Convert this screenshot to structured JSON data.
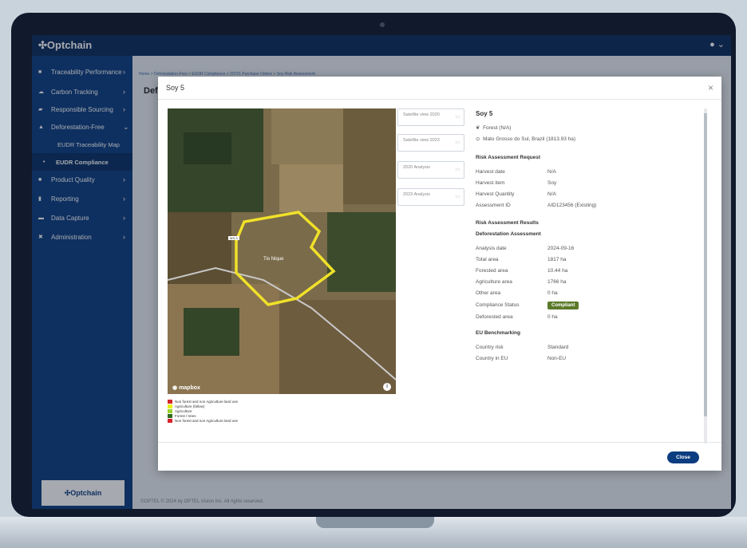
{
  "app": {
    "logo": "Optchain",
    "user_icon": "avatar-icon"
  },
  "sidebar": {
    "items": [
      {
        "label": "Traceability Performance"
      },
      {
        "label": "Carbon Tracking"
      },
      {
        "label": "Responsible Sourcing"
      },
      {
        "label": "Deforestation-Free"
      },
      {
        "label": "EUDR Traceability Map"
      },
      {
        "label": "EUDR Compliance"
      },
      {
        "label": "Product Quality"
      },
      {
        "label": "Reporting"
      },
      {
        "label": "Data Capture"
      },
      {
        "label": "Administration"
      }
    ],
    "footer_logo": "Optchain"
  },
  "page": {
    "breadcrumb": "Home > Deforestation-Free > EUDR Compliance > 20721 Purchase Orders > Soy Risk Assessment",
    "title": "Def",
    "footer": "©OPTEL © 2024 by OPTEL Vision Inc. All rights reserved."
  },
  "modal": {
    "title": "Soy 5",
    "close_icon": "×",
    "map": {
      "attribution": "mapbox",
      "place_label": "Tio Nique",
      "road_label": "MS-3"
    },
    "legend": [
      {
        "label": "Non forest and non Agriculture land use",
        "color": "#d6242e"
      },
      {
        "label": "Agriculture (fallow)",
        "color": "#e6ee1c"
      },
      {
        "label": "Agriculture",
        "color": "#9bd330"
      },
      {
        "label": "Forest / trees",
        "color": "#2f6b1d"
      },
      {
        "label": "Non forest and non Agriculture land use",
        "color": "#d6242e"
      }
    ],
    "tiles": [
      {
        "label": "Satellite view 2020"
      },
      {
        "label": "Satellite view 2023"
      },
      {
        "label": "2020 Analysis"
      },
      {
        "label": "2023 Analysis"
      }
    ],
    "info": {
      "name": "Soy 5",
      "forest": "Forest (N/A)",
      "location": "Mato Grosso do Sul, Brazil (1813.93 ha)",
      "request_heading": "Risk Assessment Request",
      "request": [
        {
          "key": "Harvest date",
          "value": "N/A"
        },
        {
          "key": "Harvest item",
          "value": "Soy"
        },
        {
          "key": "Harvest Quantity",
          "value": "N/A"
        },
        {
          "key": "Assessment ID",
          "value": "AID123456 (Existing)"
        }
      ],
      "results_heading": "Risk Assessment Results",
      "deforestation_heading": "Deforestation Assessment",
      "results": [
        {
          "key": "Analysis date",
          "value": "2024-09-16"
        },
        {
          "key": "Total area",
          "value": "1817 ha"
        },
        {
          "key": "Forested area",
          "value": "10.44 ha"
        },
        {
          "key": "Agriculture area",
          "value": "1766 ha"
        },
        {
          "key": "Other area",
          "value": "0 ha"
        },
        {
          "key": "Compliance Status",
          "value": "Compliant"
        },
        {
          "key": "Deforested area",
          "value": "0 ha"
        }
      ],
      "eu_heading": "EU Benchmarking",
      "eu": [
        {
          "key": "Country risk",
          "value": "Standard"
        },
        {
          "key": "Country in EU",
          "value": "Non-EU"
        }
      ]
    },
    "close_button": "Close"
  },
  "colors": {
    "navy": "#0b3d80",
    "compliant": "#5b7a2a",
    "polygon": "#f0e12a"
  }
}
